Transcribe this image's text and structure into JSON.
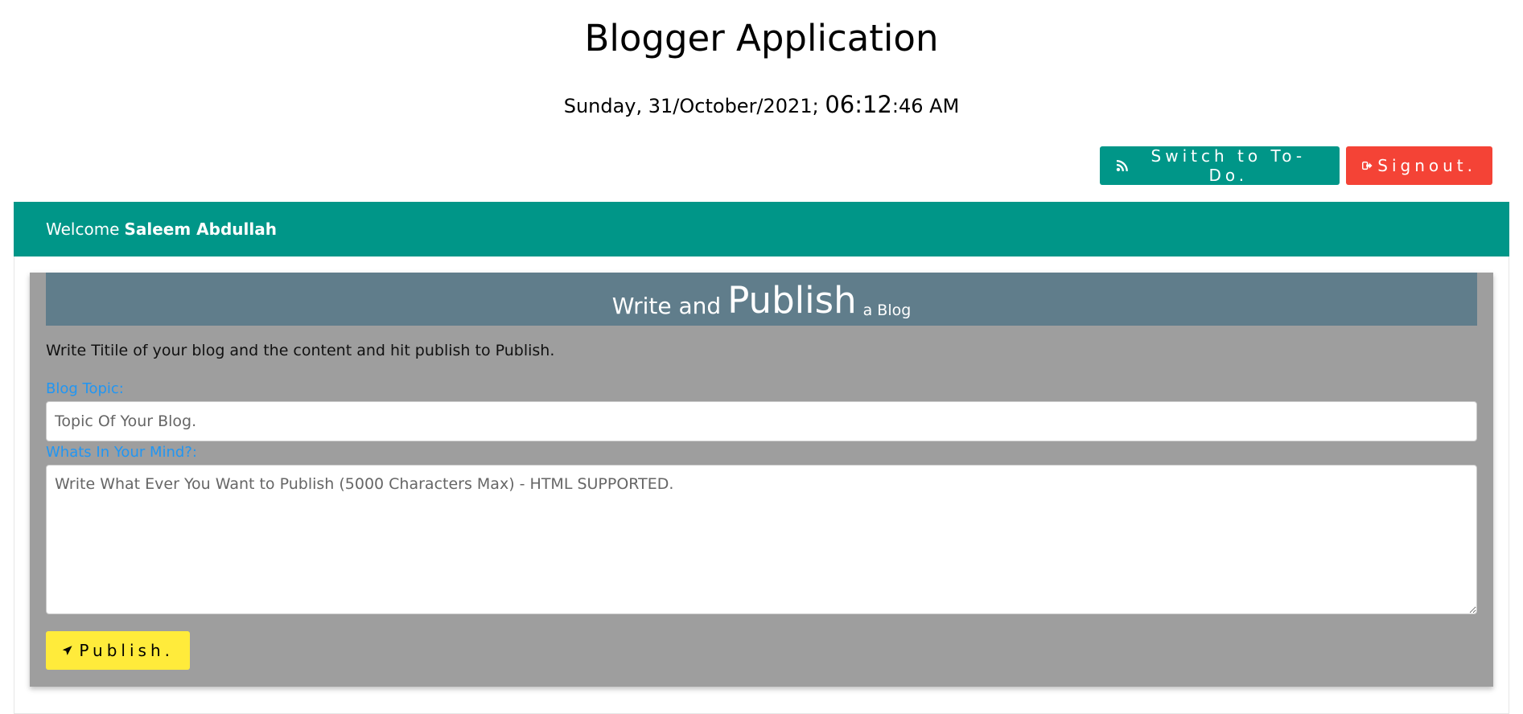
{
  "app": {
    "title": "Blogger Application",
    "date": "Sunday, 31/October/2021;",
    "time_main": "06:12",
    "time_rest": ":46 AM"
  },
  "actions": {
    "todo_label": "Switch to To-Do.",
    "todo_icon": "rss-icon",
    "signout_label": "Signout.",
    "signout_icon": "sign-out-icon"
  },
  "welcome": {
    "prefix": "Welcome",
    "user_name": "Saleem Abdullah"
  },
  "editor": {
    "header_part1": "Write and",
    "header_part2": "Publish",
    "header_part3": "a Blog",
    "instructions": "Write Titile of your blog and the content and hit publish to Publish.",
    "topic_label": "Blog Topic:",
    "topic_placeholder": "Topic Of Your Blog.",
    "content_label": "Whats In Your Mind?:",
    "content_placeholder": "Write What Ever You Want to Publish (5000 Characters Max) - HTML SUPPORTED.",
    "publish_label": "Publish.",
    "publish_icon": "paper-plane-icon"
  },
  "colors": {
    "teal": "#009688",
    "red": "#f44336",
    "panel_gray": "#9e9e9e",
    "header_bluegray": "#607d8b",
    "label_blue": "#2196f3",
    "publish_yellow": "#ffeb3b"
  }
}
